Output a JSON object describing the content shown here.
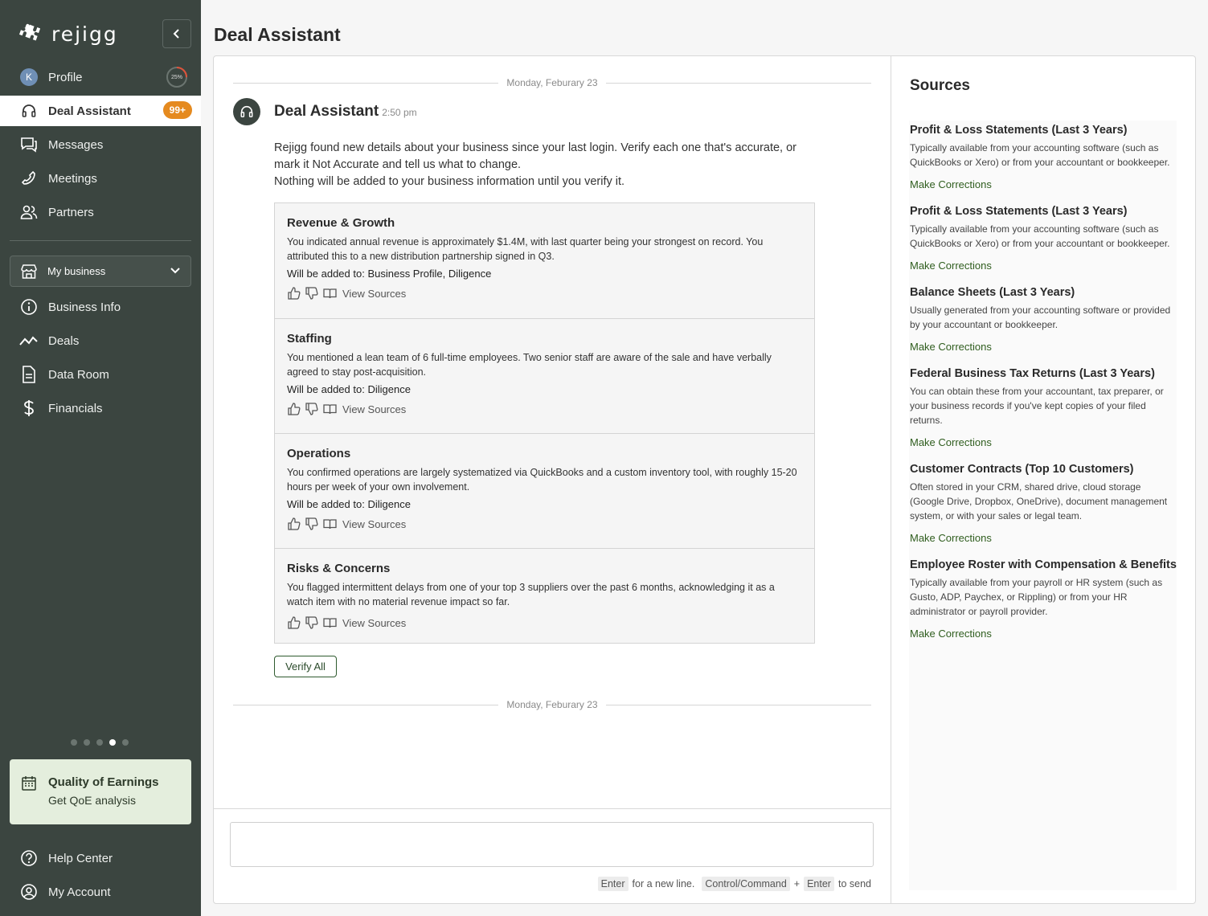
{
  "brand": {
    "name": "rejigg"
  },
  "sidebar": {
    "profile": {
      "label": "Profile",
      "avatar_initial": "K",
      "progress_text": "25%",
      "progress": 0.25
    },
    "deal_assistant": {
      "label": "Deal Assistant",
      "badge": "99+"
    },
    "messages": {
      "label": "Messages"
    },
    "meetings": {
      "label": "Meetings"
    },
    "partners": {
      "label": "Partners"
    },
    "business_select": {
      "label": "My business"
    },
    "business_info": {
      "label": "Business Info"
    },
    "deals": {
      "label": "Deals"
    },
    "data_room": {
      "label": "Data Room"
    },
    "financials": {
      "label": "Financials"
    },
    "carousel_active_index": 3,
    "carousel_count": 5,
    "qoe": {
      "title": "Quality of Earnings",
      "subtitle": "Get QoE analysis"
    },
    "help_center": {
      "label": "Help Center"
    },
    "my_account": {
      "label": "My Account"
    }
  },
  "page": {
    "title": "Deal Assistant"
  },
  "chat": {
    "date_top": "Monday, Feburary 23",
    "date_bottom": "Monday, Feburary 23",
    "sender": "Deal Assistant",
    "time": "2:50 pm",
    "intro_line1": "Rejigg found new details about your business since your last login. Verify each one that's accurate, or mark it Not Accurate and tell us what to change.",
    "intro_line2": "Nothing will be added to your business information until you verify it.",
    "cards": [
      {
        "title": "Revenue & Growth",
        "desc": "You indicated annual revenue is approximately $1.4M, with last quarter being your strongest on record. You attributed this to a new distribution partnership signed in Q3.",
        "dest": "Will be added to: Business Profile, Diligence",
        "view_sources": "View Sources"
      },
      {
        "title": "Staffing",
        "desc": "You mentioned a lean team of 6 full-time employees. Two senior staff are aware of the sale and have verbally agreed to stay post-acquisition.",
        "dest": "Will be added to: Diligence",
        "view_sources": "View Sources"
      },
      {
        "title": "Operations",
        "desc": "You confirmed operations are largely systematized via QuickBooks and a custom inventory tool, with roughly 15-20 hours per week of your own involvement.",
        "dest": "Will be added to: Diligence",
        "view_sources": "View Sources"
      },
      {
        "title": "Risks & Concerns",
        "desc": "You flagged intermittent delays from one of your top 3 suppliers over the past 6 months, acknowledging it as a watch item with no material revenue impact so far.",
        "dest": "",
        "view_sources": "View Sources"
      }
    ],
    "verify_all": "Verify All"
  },
  "composer": {
    "placeholder": "",
    "hint_enter": "Enter",
    "hint_newline": "for a new line.",
    "hint_ctrl": "Control/Command",
    "hint_plus": "+",
    "hint_enter2": "Enter",
    "hint_send": "to send"
  },
  "sources": {
    "title": "Sources",
    "items": [
      {
        "title": "Profit & Loss Statements (Last 3 Years)",
        "desc": "Typically available from your accounting software (such as QuickBooks or Xero) or from your accountant or bookkeeper.",
        "link": "Make Corrections"
      },
      {
        "title": "Profit & Loss Statements (Last 3 Years)",
        "desc": "Typically available from your accounting software (such as QuickBooks or Xero) or from your accountant or bookkeeper.",
        "link": "Make Corrections"
      },
      {
        "title": "Balance Sheets (Last 3 Years)",
        "desc": "Usually generated from your accounting software or provided by your accountant or bookkeeper.",
        "link": "Make Corrections"
      },
      {
        "title": "Federal Business Tax Returns (Last 3 Years)",
        "desc": "You can obtain these from your accountant, tax preparer, or your business records if you've kept copies of your filed returns.",
        "link": "Make Corrections"
      },
      {
        "title": "Customer Contracts (Top 10 Customers)",
        "desc": "Often stored in your CRM, shared drive, cloud storage (Google Drive, Dropbox, OneDrive), document management system, or with your sales or legal team.",
        "link": "Make Corrections"
      },
      {
        "title": "Employee Roster with Compensation & Benefits",
        "desc": "Typically available from your payroll or HR system (such as Gusto, ADP, Paychex, or Rippling) or from your HR administrator or payroll provider.",
        "link": "Make Corrections"
      }
    ]
  },
  "colors": {
    "sidebar_bg": "#3b4540",
    "badge": "#e58a1f",
    "accent_green": "#2f5d1e",
    "qoe_bg": "#e4eedd"
  },
  "icons": [
    "puzzle-logo-icon",
    "chevron-left-icon",
    "headset-icon",
    "messages-icon",
    "phone-icon",
    "partners-icon",
    "storefront-icon",
    "chevron-down-icon",
    "info-icon",
    "trend-icon",
    "document-icon",
    "dollar-icon",
    "calendar-icon",
    "help-icon",
    "account-icon",
    "thumbs-up-icon",
    "thumbs-down-icon",
    "book-icon"
  ]
}
